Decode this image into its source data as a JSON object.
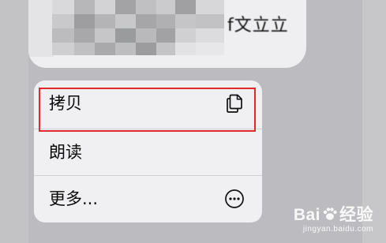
{
  "message": {
    "pixelated_text": "f文立立"
  },
  "context_menu": {
    "items": [
      {
        "label": "拷贝",
        "icon": "copy-icon",
        "highlighted": true
      },
      {
        "label": "朗读",
        "icon": ""
      },
      {
        "label": "更多...",
        "icon": "more-ellipsis-circle-icon"
      }
    ]
  },
  "highlight_color": "#e02a2e",
  "watermark": {
    "logo_text_left": "Bai",
    "logo_text_right": "经验",
    "site": "jingyan.baidu.com"
  }
}
